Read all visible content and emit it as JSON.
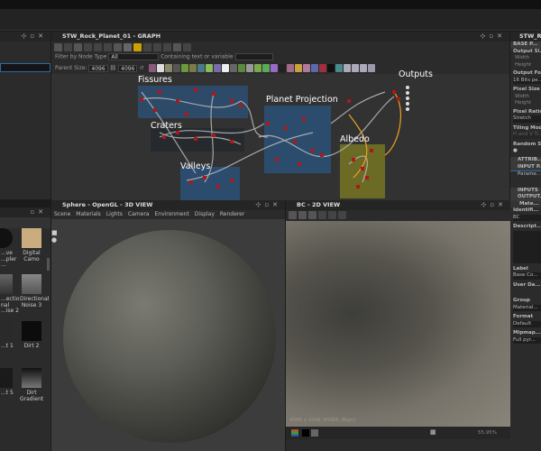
{
  "graph": {
    "title": "STW_Rock_Planet_01 - GRAPH",
    "filter_label": "Filter by Node Type",
    "filter_value": "All",
    "contains_label": "Containing text or variable",
    "parent_size_label": "Parent Size:",
    "parent_size": "4096",
    "size2": "4096",
    "frames": [
      "Fissures",
      "Craters",
      "Planet Projection",
      "Valleys",
      "Albedo",
      "Outputs"
    ]
  },
  "view3d": {
    "title": "Sphere - OpenGL - 3D VIEW",
    "menu": [
      "Scene",
      "Materials",
      "Lights",
      "Camera",
      "Environment",
      "Display",
      "Renderer"
    ]
  },
  "view2d": {
    "title": "BC - 2D VIEW",
    "info": "4096 x 2048 (RGBA, 8bpc)",
    "zoom": "55.95%"
  },
  "library": {
    "items": [
      {
        "l1": "...ve",
        "l2": "...pler ..."
      },
      {
        "l1": "Digital",
        "l2": "Camo"
      },
      {
        "l1": "...ectional",
        "l2": "...ise 2"
      },
      {
        "l1": "Directional",
        "l2": "Noise 3"
      },
      {
        "l1": "...t 1",
        "l2": ""
      },
      {
        "l1": "Dirt 2",
        "l2": ""
      },
      {
        "l1": "...t 5",
        "l2": ""
      },
      {
        "l1": "Dirt",
        "l2": "Gradient"
      }
    ]
  },
  "props": {
    "title": "STW_R...",
    "base": "BASE P...",
    "output_size": "Output Si...",
    "width": "Width",
    "height": "Height",
    "output_format": "Output Fo...",
    "format_value": "16 Bits pe...",
    "pixel_size": "Pixel Size",
    "pixel_ratio": "Pixel Ratio",
    "stretch": "Stretch",
    "tiling": "Tiling Mod...",
    "tiling_value": "H and V Ti...",
    "random": "Random S...",
    "attrib": "ATTRIB...",
    "input": "INPUT P...",
    "param": "Parame...",
    "inputs": "INPUTS",
    "outputs": "OUTPUT...",
    "material": "Mate...",
    "identifier": "Identifi...",
    "id_value": "BC",
    "description": "Descript...",
    "label": "Label",
    "label_value": "Base Co...",
    "user_data": "User Da...",
    "group": "Group",
    "group_value": "Material...",
    "format": "Format",
    "format2": "Default",
    "mipmaps": "Mipmap...",
    "mip_value": "Full pyr..."
  }
}
